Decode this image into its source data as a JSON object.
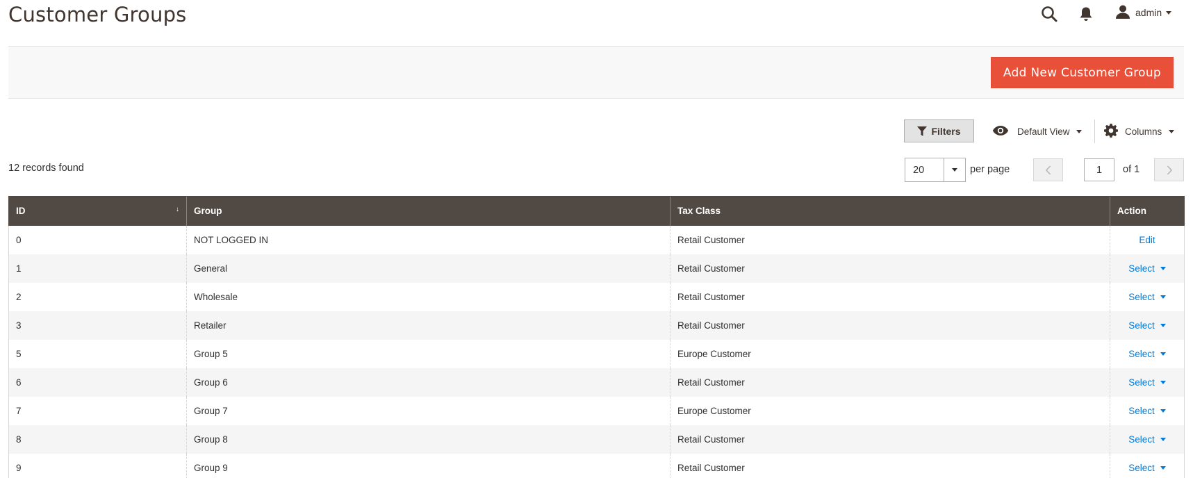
{
  "page": {
    "title": "Customer Groups"
  },
  "header": {
    "user": "admin"
  },
  "actions": {
    "add_button": "Add New Customer Group"
  },
  "toolbar": {
    "filters_label": "Filters",
    "view_label": "Default View",
    "columns_label": "Columns",
    "records_found": "12 records found",
    "per_page_value": "20",
    "per_page_label": "per page",
    "current_page": "1",
    "of_pages": "of 1"
  },
  "table": {
    "columns": [
      "ID",
      "Group",
      "Tax Class",
      "Action"
    ],
    "sort_indicator": "↓",
    "rows": [
      {
        "id": "0",
        "group": "NOT LOGGED IN",
        "tax_class": "Retail Customer",
        "action": "Edit"
      },
      {
        "id": "1",
        "group": "General",
        "tax_class": "Retail Customer",
        "action": "Select"
      },
      {
        "id": "2",
        "group": "Wholesale",
        "tax_class": "Retail Customer",
        "action": "Select"
      },
      {
        "id": "3",
        "group": "Retailer",
        "tax_class": "Retail Customer",
        "action": "Select"
      },
      {
        "id": "5",
        "group": "Group 5",
        "tax_class": "Europe Customer",
        "action": "Select"
      },
      {
        "id": "6",
        "group": "Group 6",
        "tax_class": "Retail Customer",
        "action": "Select"
      },
      {
        "id": "7",
        "group": "Group 7",
        "tax_class": "Europe Customer",
        "action": "Select"
      },
      {
        "id": "8",
        "group": "Group 8",
        "tax_class": "Retail Customer",
        "action": "Select"
      },
      {
        "id": "9",
        "group": "Group 9",
        "tax_class": "Retail Customer",
        "action": "Select"
      }
    ]
  },
  "icons": {
    "search": "search-icon",
    "notifications": "bell-icon",
    "user": "user-icon",
    "filter": "funnel-icon",
    "view": "eye-icon",
    "columns": "gear-icon"
  },
  "colors": {
    "primary_button": "#e8503a",
    "table_header": "#514943",
    "link": "#007bdb"
  }
}
